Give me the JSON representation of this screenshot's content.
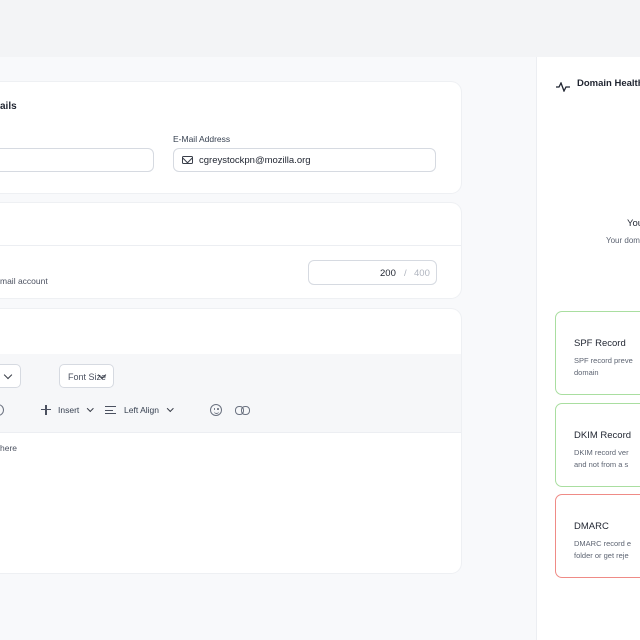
{
  "details_card": {
    "title_partial": "ails",
    "email_label": "E-Mail Address",
    "email_value": "cgreystockpn@mozilla.org",
    "email_icon": "mail-icon"
  },
  "quota_card": {
    "description_partial": "mail account",
    "quota_value": "200",
    "quota_separator": "/",
    "quota_max": "400"
  },
  "editor_card": {
    "font_size_label": "Font Size",
    "insert_label": "Insert",
    "align_label": "Left Align",
    "placeholder_partial": "here"
  },
  "domain_health": {
    "title": "Domain Health",
    "summary_title_partial": "You",
    "summary_desc_partial": "Your dom",
    "cards": [
      {
        "title": "SPF Record",
        "desc_line1": "SPF record preve",
        "desc_line2": "domain",
        "status": "good"
      },
      {
        "title": "DKIM Record",
        "desc_line1": "DKIM record ver",
        "desc_line2": "and not from a s",
        "status": "good"
      },
      {
        "title": "DMARC",
        "desc_line1": "DMARC record e",
        "desc_line2": "folder or get reje",
        "status": "bad"
      }
    ],
    "colors": {
      "good_border": "#a9dea0",
      "bad_border": "#ef8b86"
    }
  }
}
